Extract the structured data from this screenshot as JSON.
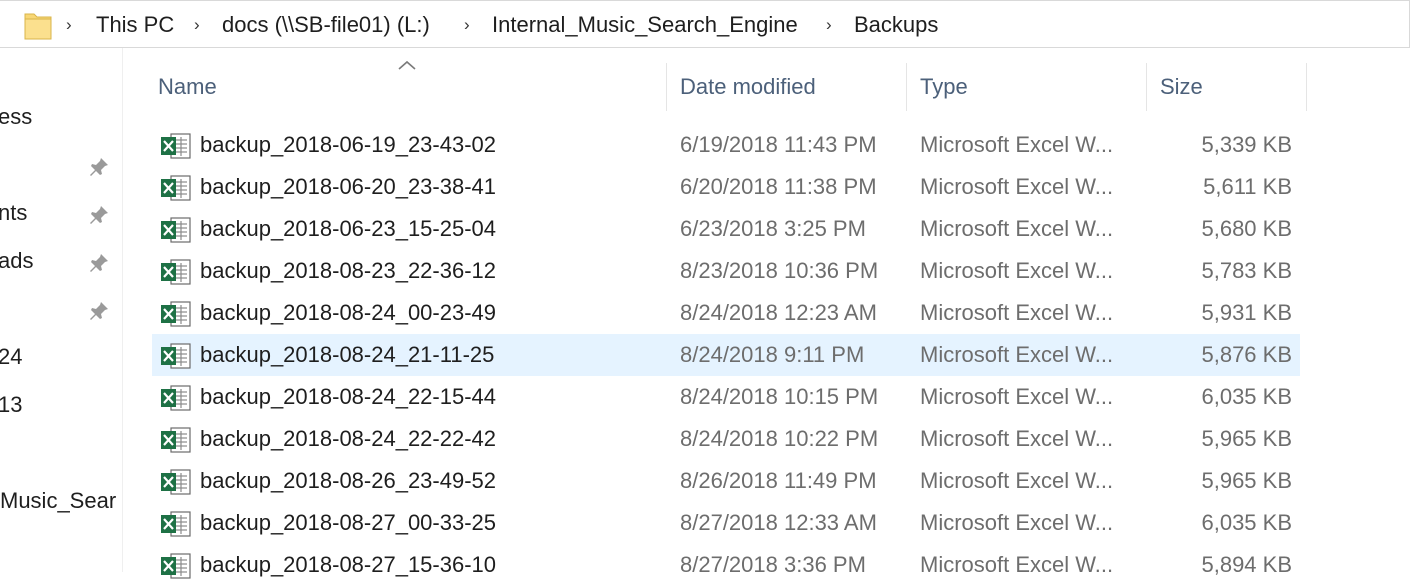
{
  "address_bar": {
    "crumbs": [
      "This PC",
      "docs (\\\\SB-file01) (L:)",
      "Internal_Music_Search_Engine",
      "Backups"
    ]
  },
  "nav_pane": {
    "items": [
      {
        "label": "ess",
        "pinned": false
      },
      {
        "label": "",
        "pinned": true
      },
      {
        "label": "nts",
        "pinned": true
      },
      {
        "label": "ads",
        "pinned": true
      },
      {
        "label": "",
        "pinned": true
      },
      {
        "label": "24",
        "pinned": false
      },
      {
        "label": "13",
        "pinned": false
      },
      {
        "label": "Music_Sear",
        "pinned": false
      }
    ]
  },
  "columns": {
    "name": "Name",
    "date_modified": "Date modified",
    "type": "Type",
    "size": "Size"
  },
  "files": [
    {
      "name": "backup_2018-06-19_23-43-02",
      "date": "6/19/2018 11:43 PM",
      "type": "Microsoft Excel W...",
      "size": "5,339 KB",
      "selected": false
    },
    {
      "name": "backup_2018-06-20_23-38-41",
      "date": "6/20/2018 11:38 PM",
      "type": "Microsoft Excel W...",
      "size": "5,611 KB",
      "selected": false
    },
    {
      "name": "backup_2018-06-23_15-25-04",
      "date": "6/23/2018 3:25 PM",
      "type": "Microsoft Excel W...",
      "size": "5,680 KB",
      "selected": false
    },
    {
      "name": "backup_2018-08-23_22-36-12",
      "date": "8/23/2018 10:36 PM",
      "type": "Microsoft Excel W...",
      "size": "5,783 KB",
      "selected": false
    },
    {
      "name": "backup_2018-08-24_00-23-49",
      "date": "8/24/2018 12:23 AM",
      "type": "Microsoft Excel W...",
      "size": "5,931 KB",
      "selected": false
    },
    {
      "name": "backup_2018-08-24_21-11-25",
      "date": "8/24/2018 9:11 PM",
      "type": "Microsoft Excel W...",
      "size": "5,876 KB",
      "selected": true
    },
    {
      "name": "backup_2018-08-24_22-15-44",
      "date": "8/24/2018 10:15 PM",
      "type": "Microsoft Excel W...",
      "size": "6,035 KB",
      "selected": false
    },
    {
      "name": "backup_2018-08-24_22-22-42",
      "date": "8/24/2018 10:22 PM",
      "type": "Microsoft Excel W...",
      "size": "5,965 KB",
      "selected": false
    },
    {
      "name": "backup_2018-08-26_23-49-52",
      "date": "8/26/2018 11:49 PM",
      "type": "Microsoft Excel W...",
      "size": "5,965 KB",
      "selected": false
    },
    {
      "name": "backup_2018-08-27_00-33-25",
      "date": "8/27/2018 12:33 AM",
      "type": "Microsoft Excel W...",
      "size": "6,035 KB",
      "selected": false
    },
    {
      "name": "backup_2018-08-27_15-36-10",
      "date": "8/27/2018 3:36 PM",
      "type": "Microsoft Excel W...",
      "size": "5,894 KB",
      "selected": false
    }
  ],
  "icons": {
    "file_icon": "excel-file-icon",
    "folder_icon": "folder-icon",
    "pin_icon": "pin-icon",
    "breadcrumb_separator": "chevron-right-icon",
    "sort_indicator": "sort-ascending-icon"
  },
  "colors": {
    "selection": "#e5f3ff",
    "header_text": "#4c607a",
    "excel_green": "#1e7145",
    "folder_yellow": "#f8d775"
  }
}
